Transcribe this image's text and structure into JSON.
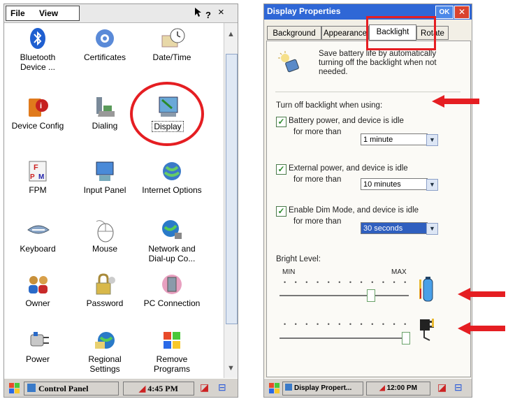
{
  "left": {
    "menu": {
      "file": "File",
      "view": "View",
      "help": "?",
      "close": "×"
    },
    "items": [
      {
        "label": "Bluetooth Device ...",
        "icon": "bluetooth-icon"
      },
      {
        "label": "Certificates",
        "icon": "certificates-icon"
      },
      {
        "label": "Date/Time",
        "icon": "clock-icon"
      },
      {
        "label": "Device Config",
        "icon": "device-config-icon"
      },
      {
        "label": "Dialing",
        "icon": "dialing-icon"
      },
      {
        "label": "Display",
        "icon": "display-icon"
      },
      {
        "label": "FPM",
        "icon": "fpm-icon"
      },
      {
        "label": "Input Panel",
        "icon": "input-panel-icon"
      },
      {
        "label": "Internet Options",
        "icon": "internet-options-icon"
      },
      {
        "label": "Keyboard",
        "icon": "keyboard-icon"
      },
      {
        "label": "Mouse",
        "icon": "mouse-icon"
      },
      {
        "label": "Network and Dial-up Co...",
        "icon": "network-icon"
      },
      {
        "label": "Owner",
        "icon": "owner-icon"
      },
      {
        "label": "Password",
        "icon": "password-icon"
      },
      {
        "label": "PC Connection",
        "icon": "pc-connection-icon"
      },
      {
        "label": "Power",
        "icon": "power-icon"
      },
      {
        "label": "Regional Settings",
        "icon": "regional-settings-icon"
      },
      {
        "label": "Remove Programs",
        "icon": "remove-programs-icon"
      }
    ],
    "taskbar": {
      "window": "Control Panel",
      "time": "4:45 PM"
    }
  },
  "right": {
    "title": "Display Properties",
    "ok": "OK",
    "tabs": [
      "Background",
      "Appearance",
      "Backlight",
      "Rotate"
    ],
    "active_tab": "Backlight",
    "intro": "Save battery life by automatically turning off the backlight when not needed.",
    "turn_off_heading": "Turn off backlight when using:",
    "options": [
      {
        "checked": true,
        "text": "Battery power, and device is idle",
        "for_more": "for more than",
        "value": "1 minute"
      },
      {
        "checked": true,
        "text": "External power, and device is idle",
        "for_more": "for more than",
        "value": "10 minutes"
      },
      {
        "checked": true,
        "text": "Enable Dim Mode, and device is idle",
        "for_more": "for more than",
        "value": "30 seconds"
      }
    ],
    "bright_level": "Bright Level:",
    "min": "MIN",
    "max": "MAX",
    "slider_battery_level": 0.7,
    "slider_external_level": 1.0,
    "taskbar": {
      "window": "Display Propert...",
      "time": "12:00 PM"
    }
  },
  "colors": {
    "highlight": "#e51e22",
    "titlebar": "#2f67d6"
  }
}
